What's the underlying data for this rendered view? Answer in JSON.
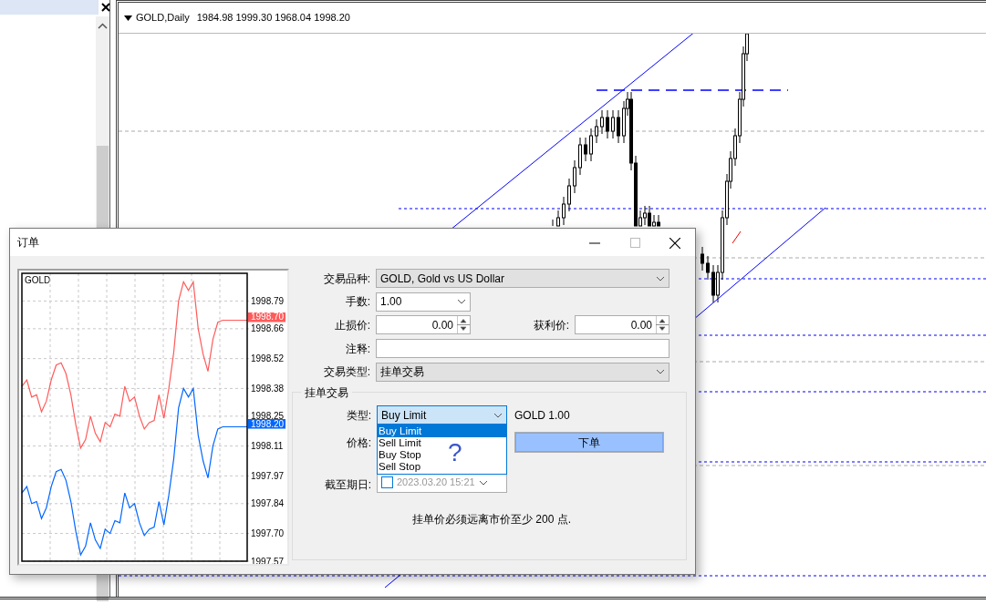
{
  "chart_window": {
    "header": {
      "symbol": "GOLD,Daily",
      "ohlc": "1984.98 1999.30 1968.04 1998.20"
    }
  },
  "order_dialog": {
    "title": "订单",
    "tick_chart": {
      "chart_data": {
        "type": "line",
        "title": "GOLD",
        "grid": true,
        "ylim": [
          1997.57,
          1998.92
        ],
        "yticks": [
          1997.57,
          {
            "value": 1997.7,
            "label": "1997.70"
          },
          1997.84,
          1997.97,
          1998.11,
          1998.25,
          1998.38,
          1998.52,
          1998.66,
          1998.79
        ],
        "series": [
          {
            "color": "#ff5b5b",
            "values": [
              1998.39,
              1998.42,
              1998.34,
              1998.35,
              1998.27,
              1998.32,
              1998.42,
              1998.49,
              1998.5,
              1998.45,
              1998.35,
              1998.21,
              1998.1,
              1998.14,
              1998.25,
              1998.17,
              1998.13,
              1998.22,
              1998.2,
              1998.26,
              1998.25,
              1998.39,
              1998.32,
              1998.34,
              1998.25,
              1998.19,
              1998.22,
              1998.23,
              1998.35,
              1998.24,
              1998.38,
              1998.55,
              1998.79,
              1998.88,
              1998.84,
              1998.88,
              1998.66,
              1998.54,
              1998.46,
              1998.61,
              1998.69,
              1998.7,
              1998.7,
              1998.7,
              1998.7,
              1998.7,
              1998.7
            ]
          },
          {
            "color": "#0066ff",
            "values": [
              1997.89,
              1997.92,
              1997.84,
              1997.85,
              1997.77,
              1997.82,
              1997.92,
              1997.99,
              1998.0,
              1997.95,
              1997.85,
              1997.71,
              1997.6,
              1997.64,
              1997.75,
              1997.67,
              1997.63,
              1997.72,
              1997.7,
              1997.76,
              1997.75,
              1997.89,
              1997.82,
              1997.84,
              1997.75,
              1997.69,
              1997.72,
              1997.73,
              1997.85,
              1997.74,
              1997.88,
              1998.05,
              1998.29,
              1998.38,
              1998.34,
              1998.38,
              1998.16,
              1998.04,
              1997.96,
              1998.11,
              1998.19,
              1998.2,
              1998.2,
              1998.2,
              1998.2,
              1998.2,
              1998.2
            ]
          }
        ],
        "annotations": [
          "1998.70",
          "1998.20"
        ]
      }
    },
    "fields": [
      {
        "kind": "combo",
        "label": "交易品种:",
        "value": "GOLD, Gold vs US Dollar"
      },
      {
        "kind": "amount",
        "label": "手数:",
        "value": "1.00"
      },
      {
        "kind": "spinpair",
        "label": "止损价:",
        "value": "0.00",
        "label2": "获利价:",
        "value2": "0.00"
      },
      {
        "kind": "text",
        "label": "注释:"
      },
      {
        "kind": "combo",
        "label": "交易类型:",
        "value": "挂单交易"
      }
    ],
    "pending": {
      "title": "挂单交易",
      "type": {
        "label": "类型:",
        "value": "Buy Limit",
        "expanded": true,
        "info": "GOLD 1.00",
        "options": [
          {
            "label": "Buy Limit",
            "selected": true
          },
          {
            "label": "Sell Limit",
            "selected": false
          },
          {
            "label": "Buy Stop",
            "selected": false
          },
          {
            "label": "Sell Stop",
            "selected": false
          }
        ]
      },
      "price": {
        "label": "价格:"
      },
      "submit": "下单",
      "expiry": {
        "label": "截至期日:",
        "checked": false,
        "value": "2023.03.20 15:21"
      },
      "note": "挂单价必须远离市价至少 200 点.",
      "annotation": "?"
    }
  }
}
